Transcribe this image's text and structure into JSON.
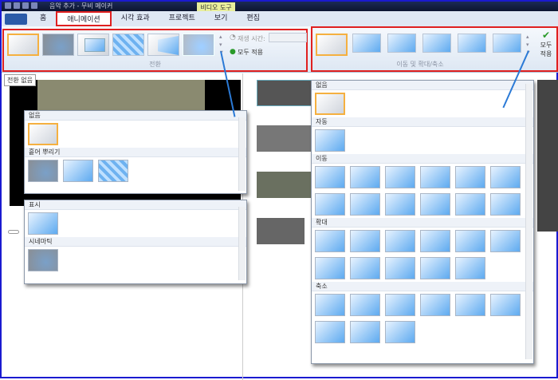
{
  "window": {
    "title": "음악 추가 - 무비 메이커",
    "context_tab": "비디오 도구"
  },
  "tabs": [
    {
      "label": "홈"
    },
    {
      "label": "애니메이션",
      "active": true
    },
    {
      "label": "시각 효과"
    },
    {
      "label": "프로젝트"
    },
    {
      "label": "보기"
    },
    {
      "label": "편집"
    }
  ],
  "ribbon": {
    "transitions": {
      "label": "전환",
      "duration_label": "재생 시간:",
      "duration_value": "",
      "apply_all": "모두 적용"
    },
    "pan_zoom": {
      "label": "이동 및 확대/축소",
      "apply_all": "모두 적용"
    }
  },
  "tooltip": "전환 없음",
  "transition_popup_1": {
    "categories": [
      {
        "name": "없음",
        "count": 1
      },
      {
        "name": "흩어 뿌리기",
        "count": 3
      }
    ]
  },
  "transition_popup_2": {
    "categories": [
      {
        "name": "표시",
        "count": 1
      },
      {
        "name": "시네마틱",
        "count": 1
      }
    ]
  },
  "panzoom_popup": {
    "categories": [
      {
        "name": "없음",
        "count": 1
      },
      {
        "name": "자동",
        "count": 1
      },
      {
        "name": "이동",
        "count": 12
      },
      {
        "name": "확대",
        "count": 11
      },
      {
        "name": "축소",
        "count": 9
      }
    ]
  },
  "colors": {
    "highlight": "#e02020",
    "arrow": "#2b7ad6",
    "selected": "#f5b040"
  }
}
